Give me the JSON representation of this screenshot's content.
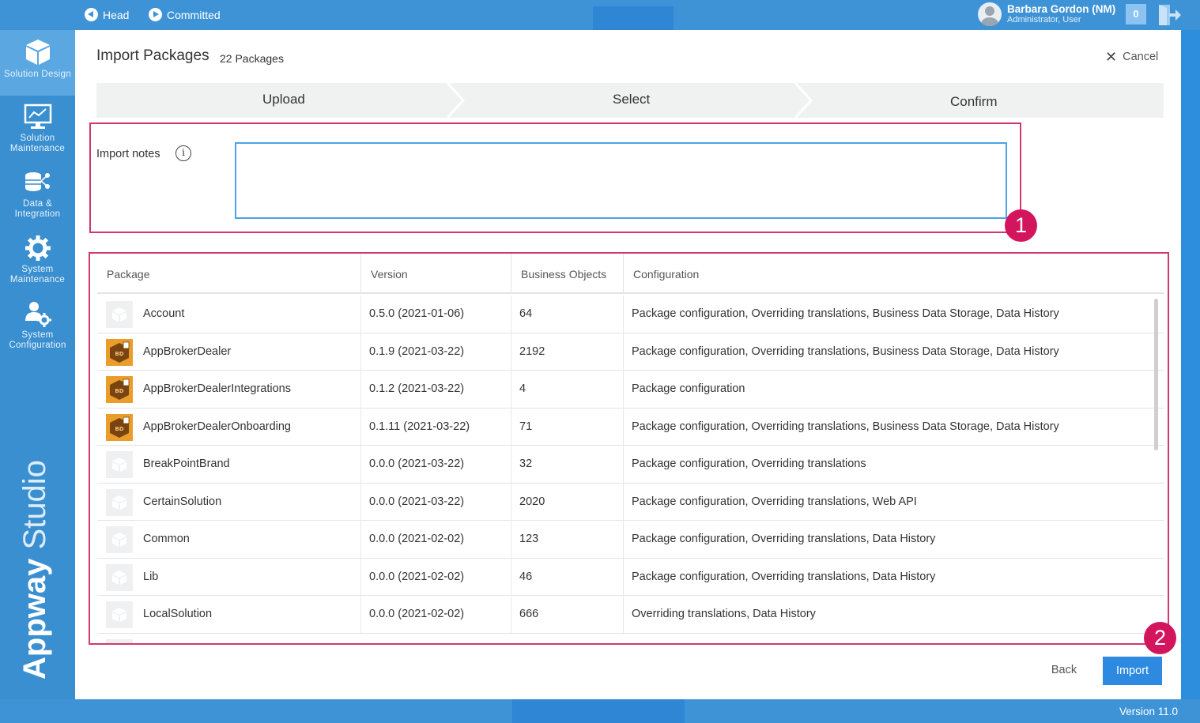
{
  "topbar": {
    "head_label": "Head",
    "committed_label": "Committed",
    "user_name": "Barbara Gordon (NM)",
    "user_role": "Administrator, User",
    "notification_count": "0"
  },
  "sidebar": {
    "items": [
      {
        "label": "Solution Design",
        "icon": "cube-icon",
        "active": true
      },
      {
        "label": "Solution Maintenance",
        "icon": "monitor-chart-icon",
        "active": false
      },
      {
        "label": "Data & Integration",
        "icon": "database-network-icon",
        "active": false
      },
      {
        "label": "System Maintenance",
        "icon": "gear-icon",
        "active": false
      },
      {
        "label": "System Configuration",
        "icon": "user-gear-icon",
        "active": false
      }
    ],
    "brand_bold": "Appway",
    "brand_light": "Studio"
  },
  "main": {
    "title": "Import Packages",
    "package_count": "22 Packages",
    "cancel_label": "Cancel",
    "steps": [
      "Upload",
      "Select",
      "Confirm"
    ],
    "notes_label": "Import notes",
    "notes_value": "",
    "badges": [
      "1",
      "2"
    ]
  },
  "table": {
    "columns": [
      "Package",
      "Version",
      "Business Objects",
      "Configuration"
    ],
    "rows": [
      {
        "icon": "package-icon",
        "name": "Account",
        "version": "0.5.0 (2021-01-06)",
        "objects": "64",
        "config": "Package configuration, Overriding translations, Business Data Storage, Data History"
      },
      {
        "icon": "bd-package-icon",
        "name": "AppBrokerDealer",
        "version": "0.1.9 (2021-03-22)",
        "objects": "2192",
        "config": "Package configuration, Overriding translations, Business Data Storage, Data History"
      },
      {
        "icon": "bd-package-icon",
        "name": "AppBrokerDealerIntegrations",
        "version": "0.1.2 (2021-03-22)",
        "objects": "4",
        "config": "Package configuration"
      },
      {
        "icon": "bd-package-icon",
        "name": "AppBrokerDealerOnboarding",
        "version": "0.1.11 (2021-03-22)",
        "objects": "71",
        "config": "Package configuration, Overriding translations, Business Data Storage, Data History"
      },
      {
        "icon": "package-icon",
        "name": "BreakPointBrand",
        "version": "0.0.0 (2021-03-22)",
        "objects": "32",
        "config": "Package configuration, Overriding translations"
      },
      {
        "icon": "package-icon",
        "name": "CertainSolution",
        "version": "0.0.0 (2021-03-22)",
        "objects": "2020",
        "config": "Package configuration, Overriding translations, Web API"
      },
      {
        "icon": "package-icon",
        "name": "Common",
        "version": "0.0.0 (2021-02-02)",
        "objects": "123",
        "config": "Package configuration, Overriding translations, Data History"
      },
      {
        "icon": "package-icon",
        "name": "Lib",
        "version": "0.0.0 (2021-02-02)",
        "objects": "46",
        "config": "Package configuration, Overriding translations, Data History"
      },
      {
        "icon": "package-icon",
        "name": "LocalSolution",
        "version": "0.0.0 (2021-02-02)",
        "objects": "666",
        "config": "Overriding translations, Data History"
      }
    ]
  },
  "footer": {
    "back_label": "Back",
    "import_label": "Import",
    "version": "Version 11.0"
  },
  "colors": {
    "brand_blue": "#3a8fd0",
    "primary_button": "#2e8ae0",
    "highlight_frame": "#d2386f",
    "badge": "#d2155d",
    "bd_package": "#ea9d2a"
  }
}
